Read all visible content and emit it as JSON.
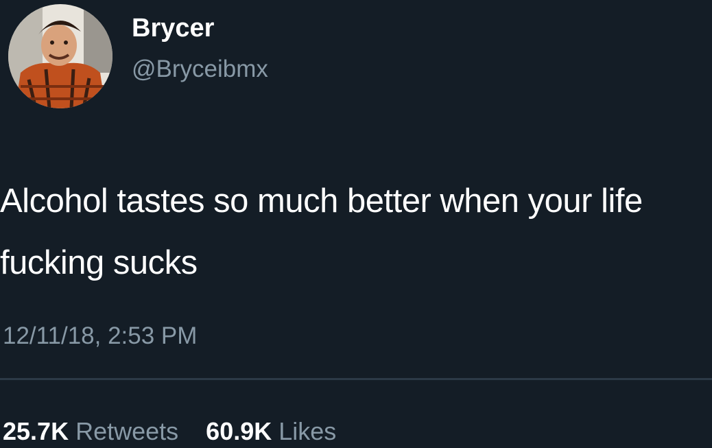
{
  "user": {
    "display_name": "Brycer",
    "handle": "@Bryceibmx"
  },
  "tweet": {
    "text": "Alcohol tastes so much better when your life fucking sucks",
    "timestamp": "12/11/18, 2:53 PM"
  },
  "stats": {
    "retweets_count": "25.7K",
    "retweets_label": "Retweets",
    "likes_count": "60.9K",
    "likes_label": "Likes"
  },
  "colors": {
    "background": "#141d26",
    "primary_text": "#ffffff",
    "secondary_text": "#8899a6"
  }
}
